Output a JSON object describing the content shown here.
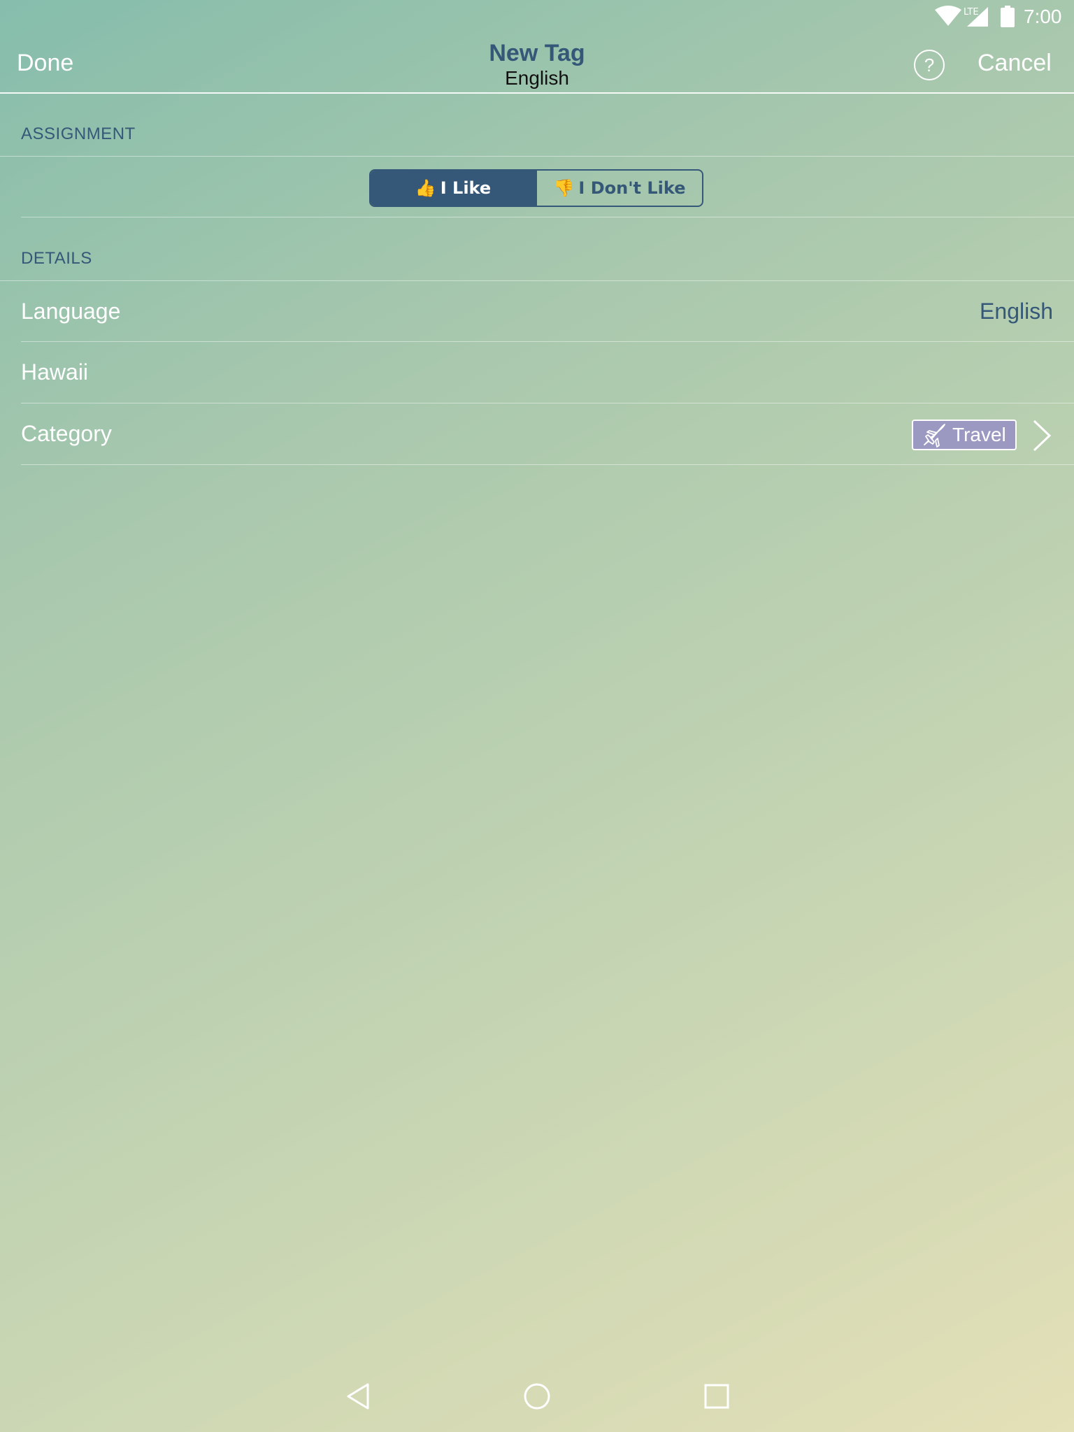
{
  "status_bar": {
    "network_label": "LTE",
    "time": "7:00"
  },
  "nav": {
    "done_label": "Done",
    "title": "New Tag",
    "subtitle": "English",
    "help_label": "?",
    "cancel_label": "Cancel"
  },
  "assignment": {
    "header": "ASSIGNMENT",
    "segments": [
      {
        "emoji": "👍",
        "label": "I Like",
        "selected": true
      },
      {
        "emoji": "👎",
        "label": "I Don't Like",
        "selected": false
      }
    ]
  },
  "details": {
    "header": "DETAILS",
    "language_label": "Language",
    "language_value": "English",
    "tag_name": "Hawaii",
    "category_label": "Category",
    "category_value": "Travel"
  },
  "colors": {
    "accent": "#355878",
    "badge": "#9b98c2"
  },
  "icons": [
    "wifi-icon",
    "signal-icon",
    "battery-icon",
    "help-icon",
    "thumbs-up-icon",
    "thumbs-down-icon",
    "airplane-icon",
    "chevron-right-icon",
    "back-icon",
    "home-icon",
    "recents-icon"
  ]
}
